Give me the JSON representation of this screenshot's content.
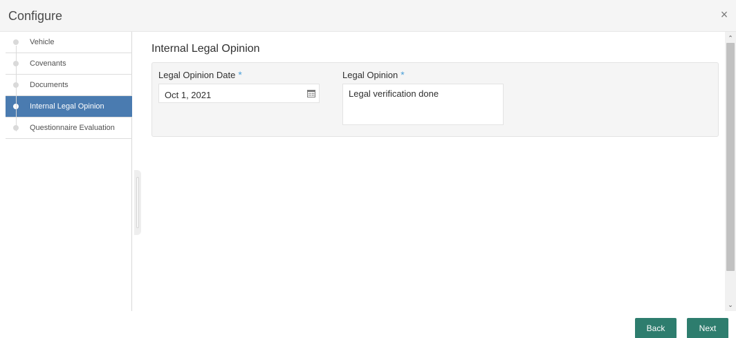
{
  "header": {
    "title": "Configure",
    "close_label": "×"
  },
  "sidebar": {
    "items": [
      {
        "label": "Vehicle",
        "active": false
      },
      {
        "label": "Covenants",
        "active": false
      },
      {
        "label": "Documents",
        "active": false
      },
      {
        "label": "Internal Legal Opinion",
        "active": true
      },
      {
        "label": "Questionnaire Evaluation",
        "active": false
      }
    ]
  },
  "main": {
    "section_title": "Internal Legal Opinion",
    "fields": {
      "date": {
        "label": "Legal Opinion Date",
        "required_mark": "*",
        "value": "Oct 1, 2021"
      },
      "opinion": {
        "label": "Legal Opinion",
        "required_mark": "*",
        "value": "Legal verification done"
      }
    }
  },
  "scrollbar": {
    "up_glyph": "⌃",
    "down_glyph": "⌄"
  },
  "footer": {
    "back_label": "Back",
    "next_label": "Next"
  },
  "colors": {
    "accent": "#4a7bb0",
    "button": "#2e7d6e",
    "required": "#4a9fd8"
  }
}
